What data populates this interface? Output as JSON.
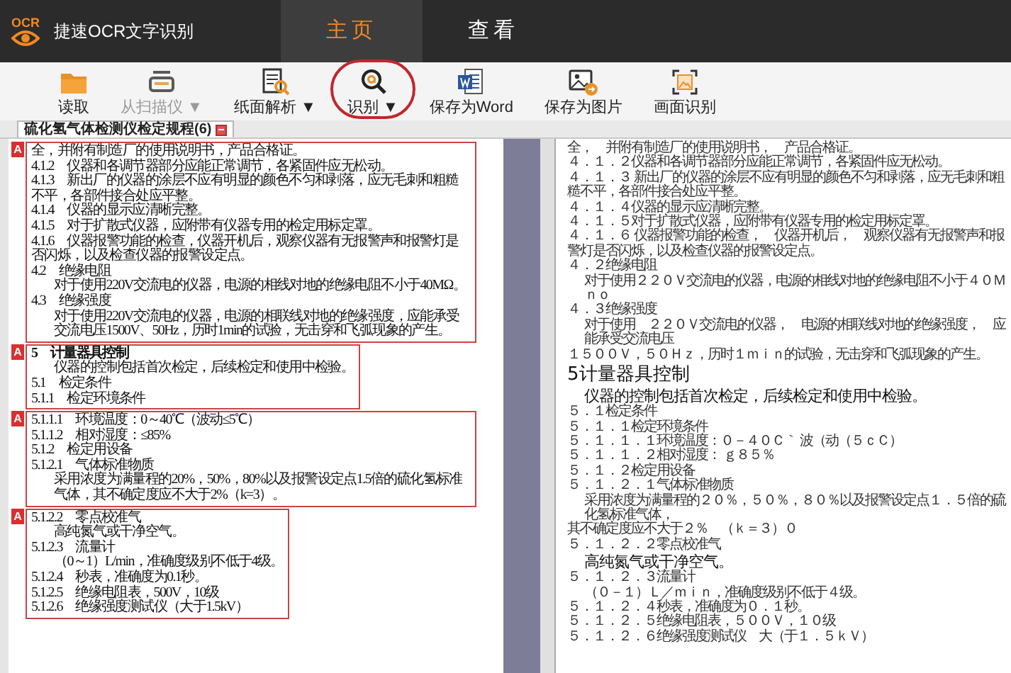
{
  "app": {
    "logo_text": "OCR",
    "title": "捷速OCR文字识别"
  },
  "nav_tabs": [
    {
      "label": "主页",
      "selected": true
    },
    {
      "label": "查看",
      "selected": false
    }
  ],
  "toolbar": [
    {
      "kind": "folder",
      "label": "读取",
      "disabled": false,
      "circled": false
    },
    {
      "kind": "scanner",
      "label": "从扫描仪",
      "caret": "▼",
      "disabled": true,
      "circled": false
    },
    {
      "kind": "parse",
      "label": "纸面解析",
      "caret": "▼",
      "disabled": false,
      "circled": false
    },
    {
      "kind": "recognize",
      "label": "识别",
      "caret": "▼",
      "disabled": false,
      "circled": true
    },
    {
      "kind": "word",
      "label": "保存为Word",
      "disabled": false,
      "circled": false
    },
    {
      "kind": "image",
      "label": "保存为图片",
      "disabled": false,
      "circled": false
    },
    {
      "kind": "frame",
      "label": "画面识别",
      "disabled": false,
      "circled": false
    }
  ],
  "document_tab": {
    "label": "硫化氢气体检测仪检定规程(6)"
  },
  "left_pane": {
    "blocks": [
      {
        "marker": "A",
        "lines": [
          {
            "kind": "body",
            "indent": false,
            "text": "全，并附有制造厂的使用说明书，产品合格证。"
          },
          {
            "kind": "body",
            "indent": false,
            "text": "4.1.2　仪器和各调节器部分应能正常调节，各紧固件应无松动。"
          },
          {
            "kind": "body",
            "indent": false,
            "text": "4.1.3　新出厂的仪器的涂层不应有明显的颜色不匀和剥落，应无毛刺和粗糙不平，各部件接合处应平整。"
          },
          {
            "kind": "body",
            "indent": false,
            "text": "4.1.4　仪器的显示应清晰完整。"
          },
          {
            "kind": "body",
            "indent": false,
            "text": "4.1.5　对于扩散式仪器，应附带有仪器专用的检定用标定罩。"
          },
          {
            "kind": "body",
            "indent": false,
            "text": "4.1.6　仪器报警功能的检查，仪器开机后，观察仪器有无报警声和报警灯是否闪烁，以及检查仪器的报警设定点。"
          },
          {
            "kind": "body",
            "indent": false,
            "text": "4.2　绝缘电阻"
          },
          {
            "kind": "body",
            "indent": true,
            "text": "对于使用220V交流电的仪器，电源的相线对地的绝缘电阻不小于40MΩ。"
          },
          {
            "kind": "body",
            "indent": false,
            "text": "4.3　绝缘强度"
          },
          {
            "kind": "body",
            "indent": true,
            "text": "对于使用220V交流电的仪器，电源的相联线对地的绝缘强度，应能承受交流电压1500V、50Hz，历时1min的试验，无击穿和飞弧现象的产生。"
          }
        ]
      },
      {
        "marker": "A",
        "lines": [
          {
            "kind": "heading",
            "indent": false,
            "text": "5　计量器具控制"
          },
          {
            "kind": "body",
            "indent": true,
            "text": "仪器的控制包括首次检定，后续检定和使用中检验。"
          },
          {
            "kind": "body",
            "indent": false,
            "text": "5.1　检定条件"
          },
          {
            "kind": "body",
            "indent": false,
            "text": "5.1.1　检定环境条件"
          }
        ]
      },
      {
        "marker": "A",
        "lines": [
          {
            "kind": "body",
            "indent": false,
            "text": "5.1.1.1　环境温度：0～40℃（波动≤5℃）"
          },
          {
            "kind": "body",
            "indent": false,
            "text": "5.1.1.2　相对湿度：≤85%"
          },
          {
            "kind": "body",
            "indent": false,
            "text": "5.1.2　检定用设备"
          },
          {
            "kind": "body",
            "indent": false,
            "text": "5.1.2.1　气体标准物质"
          },
          {
            "kind": "body",
            "indent": true,
            "text": "采用浓度为满量程的20%，50%，80%以及报警设定点1.5倍的硫化氢标准气体，其不确定度应不大于2%（k=3）。"
          }
        ]
      },
      {
        "marker": "A",
        "lines": [
          {
            "kind": "body",
            "indent": false,
            "text": "5.1.2.2　零点校准气"
          },
          {
            "kind": "body",
            "indent": true,
            "text": "高纯氮气或干净空气。"
          },
          {
            "kind": "body",
            "indent": false,
            "text": "5.1.2.3　流量计"
          },
          {
            "kind": "body",
            "indent": true,
            "text": "（0～1）L/min，准确度级别不低于4级。"
          },
          {
            "kind": "body",
            "indent": false,
            "text": "5.1.2.4　秒表，准确度为0.1秒。"
          },
          {
            "kind": "body",
            "indent": false,
            "text": "5.1.2.5　绝缘电阻表，500V，10级"
          },
          {
            "kind": "body",
            "indent": false,
            "text": "5.1.2.6　绝缘强度测试仪（大于1.5kV）"
          }
        ]
      }
    ]
  },
  "right_pane": {
    "lines": [
      {
        "kind": "small",
        "indent": false,
        "text": "全，　并附有制造厂的使用说明书，　产品合格证。"
      },
      {
        "kind": "small",
        "indent": false,
        "text": "４．１．２仪器和各调节器部分应能正常调节，各紧固件应无松动。"
      },
      {
        "kind": "small",
        "indent": false,
        "text": "４．１．３ 新出厂的仪器的涂层不应有明显的颜色不匀和剥落，应无毛刺和粗糙不平，各部件接合处应平整。"
      },
      {
        "kind": "small",
        "indent": false,
        "text": "４．１．４仪器的显示应清晰完整。"
      },
      {
        "kind": "small",
        "indent": false,
        "text": "４．１．５对于扩散式仪器，应附带有仪器专用的检定用标定罩。"
      },
      {
        "kind": "small",
        "indent": false,
        "text": "４．１．６ 仪器报警功能的检查，　仪器开机后，　观察仪器有无报警声和报警灯是否闪烁，以及检查仪器的报警设定点。"
      },
      {
        "kind": "small",
        "indent": false,
        "text": "４．２绝缘电阻"
      },
      {
        "kind": "small",
        "indent": true,
        "text": "对于使用２２０Ｖ交流电的仪器，电源的相线对地的绝缘电阻不小于４０Ｍｎｏ"
      },
      {
        "kind": "small",
        "indent": false,
        "text": "４．３绝缘强度"
      },
      {
        "kind": "small",
        "indent": true,
        "text": "对于使用　２２０Ｖ交流电的仪器，　电源的相联线对地的绝缘强度，　应能承受交流电压"
      },
      {
        "kind": "small",
        "indent": false,
        "text": "１５００Ｖ，５０Ｈｚ，历时１ｍｉｎ的试验，无击穿和飞弧现象的产生。"
      },
      {
        "kind": "heading",
        "indent": false,
        "text": "5计量器具控制"
      },
      {
        "kind": "large",
        "indent": true,
        "text": "仪器的控制包括首次检定，后续检定和使用中检验。"
      },
      {
        "kind": "small",
        "indent": false,
        "text": "５．１检定条件"
      },
      {
        "kind": "small",
        "indent": false,
        "text": "５．１．１检定环境条件"
      },
      {
        "kind": "small",
        "indent": false,
        "text": "５．１．１．１环境温度：０－４０Ｃ｀ 波（动（５ｃＣ）"
      },
      {
        "kind": "small",
        "indent": false,
        "text": "５．１．１．２相对湿度： ｇ８５％"
      },
      {
        "kind": "small",
        "indent": false,
        "text": "５．１．２检定用设备"
      },
      {
        "kind": "small",
        "indent": false,
        "text": "５．１．２．１气体标准物质"
      },
      {
        "kind": "small",
        "indent": true,
        "text": "采用浓度为满量程的２０％，５０％，８０％以及报警设定点１．５倍的硫化氢标准气体，"
      },
      {
        "kind": "small",
        "indent": false,
        "text": "其不确定度应不大于２％　（ｋ＝３）０"
      },
      {
        "kind": "small",
        "indent": false,
        "text": "５．１．２．２零点校准气"
      },
      {
        "kind": "large",
        "indent": true,
        "text": "高纯氮气或干净空气。"
      },
      {
        "kind": "small",
        "indent": false,
        "text": "５．１．２．３流量计"
      },
      {
        "kind": "small",
        "indent": true,
        "text": "（０－１）Ｌ／ｍｉｎ，准确度级别不低于４级。"
      },
      {
        "kind": "small",
        "indent": false,
        "text": "５．１．２．４秒表，准确度为０．１秒。"
      },
      {
        "kind": "small",
        "indent": false,
        "text": "５．１．２．５绝缘电阻表，５００Ｖ，１０级"
      },
      {
        "kind": "small",
        "indent": false,
        "text": "５．１．２．６绝缘强度测试仪　大（于１．５ｋＶ）"
      }
    ]
  }
}
